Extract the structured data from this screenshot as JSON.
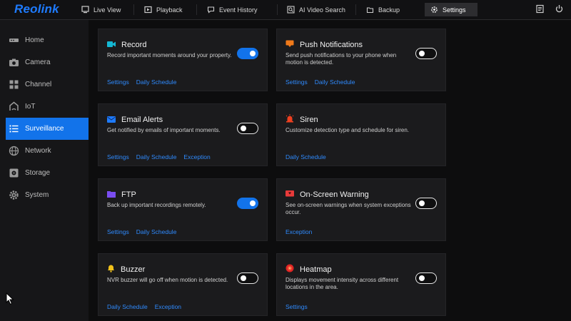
{
  "brand": "Reolink",
  "nav": {
    "tabs": [
      {
        "label": "Live View",
        "icon": "monitor-icon"
      },
      {
        "label": "Playback",
        "icon": "playback-icon"
      },
      {
        "label": "Event History",
        "icon": "event-history-icon"
      },
      {
        "label": "AI Video Search",
        "icon": "ai-search-icon"
      },
      {
        "label": "Backup",
        "icon": "backup-icon"
      },
      {
        "label": "Settings",
        "icon": "gear-icon",
        "active": true
      }
    ]
  },
  "sidebar": {
    "items": [
      {
        "label": "Home",
        "icon": "home-device-icon"
      },
      {
        "label": "Camera",
        "icon": "camera-icon"
      },
      {
        "label": "Channel",
        "icon": "channel-grid-icon"
      },
      {
        "label": "IoT",
        "icon": "iot-icon"
      },
      {
        "label": "Surveillance",
        "icon": "list-icon",
        "active": true
      },
      {
        "label": "Network",
        "icon": "globe-icon"
      },
      {
        "label": "Storage",
        "icon": "storage-icon"
      },
      {
        "label": "System",
        "icon": "gear-icon"
      }
    ]
  },
  "cards": [
    {
      "title": "Record",
      "desc": "Record important moments around your property.",
      "toggle": "on",
      "links": [
        "Settings",
        "Daily Schedule"
      ],
      "icon": "video-record-icon",
      "icon_color": "#14b8d4"
    },
    {
      "title": "Push Notifications",
      "desc": "Send push notifications to your phone when motion is detected.",
      "toggle": "off",
      "links": [
        "Settings",
        "Daily Schedule"
      ],
      "icon": "push-notification-icon",
      "icon_color": "#f07a1a"
    },
    {
      "title": "Email Alerts",
      "desc": "Get notified by emails of important moments.",
      "toggle": "off",
      "links": [
        "Settings",
        "Daily Schedule",
        "Exception"
      ],
      "icon": "email-icon",
      "icon_color": "#1e7bff"
    },
    {
      "title": "Siren",
      "desc": "Customize detection type and schedule for siren.",
      "toggle": null,
      "links": [
        "Daily Schedule"
      ],
      "icon": "siren-icon",
      "icon_color": "#ef4020"
    },
    {
      "title": "FTP",
      "desc": "Back up important recordings remotely.",
      "toggle": "on",
      "links": [
        "Settings",
        "Daily Schedule"
      ],
      "icon": "folder-icon",
      "icon_color": "#7a4df0"
    },
    {
      "title": "On-Screen Warning",
      "desc": "See on-screen warnings when system exceptions occur.",
      "toggle": "off",
      "links": [
        "Exception"
      ],
      "icon": "screen-warning-icon",
      "icon_color": "#e83a3a"
    },
    {
      "title": "Buzzer",
      "desc": "NVR buzzer will go off when motion is detected.",
      "toggle": "off",
      "links": [
        "Daily Schedule",
        "Exception"
      ],
      "icon": "bell-icon",
      "icon_color": "#f2c21a"
    },
    {
      "title": "Heatmap",
      "desc": "Displays movement intensity across different locations in the area.",
      "toggle": "off",
      "links": [
        "Settings"
      ],
      "icon": "heatmap-icon",
      "icon_color": "#e02424"
    }
  ]
}
